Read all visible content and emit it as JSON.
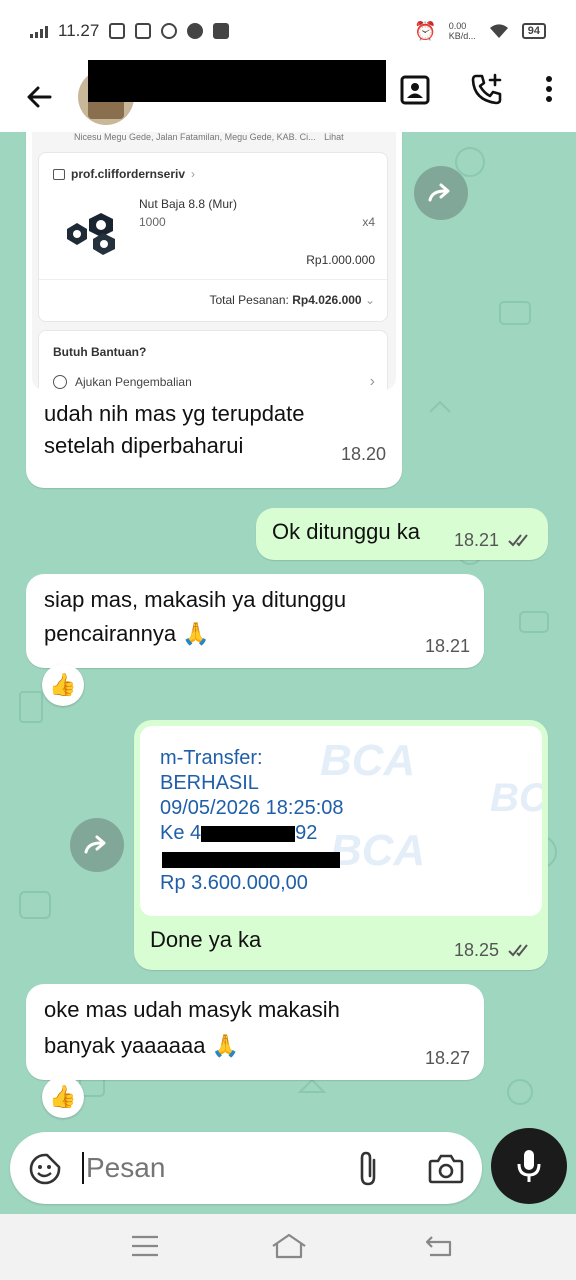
{
  "status_bar": {
    "time": "11.27",
    "net_speed_top": "0.00",
    "net_speed_bottom": "KB/d...",
    "battery": "94"
  },
  "header": {
    "back_icon": "arrow-left-icon",
    "contact_card_icon": "contact-card-icon",
    "add_call_icon": "phone-plus-icon",
    "menu_icon": "more-vertical-icon"
  },
  "messages": {
    "m1": {
      "screenshot": {
        "address_line": "Nicesu Megu Gede, Jalan Fatamilan, Megu Gede, KAB. Ci...",
        "address_link": "Lihat",
        "shop_name": "prof.cliffordernseriv",
        "product_name": "Nut Baja 8.8 (Mur)",
        "product_variant": "1000",
        "product_qty": "x4",
        "product_price": "Rp1.000.000",
        "total_label": "Total Pesanan:",
        "total_value": "Rp4.026.000",
        "help_title": "Butuh Bantuan?",
        "help_item": "Ajukan Pengembalian"
      },
      "text_line1": "udah nih mas yg terupdate",
      "text_line2": "setelah diperbaharui",
      "time": "18.20"
    },
    "m2": {
      "text": "Ok ditunggu ka",
      "time": "18.21"
    },
    "m3": {
      "text_line1": "siap mas, makasih ya ditunggu",
      "text_line2": "pencairannya 🙏",
      "time": "18.21",
      "reaction": "👍"
    },
    "m4": {
      "receipt": {
        "line1": "m-Transfer:",
        "line2": "BERHASIL",
        "line3": "09/05/2026 18:25:08",
        "line4_prefix": "Ke 4",
        "line4_suffix": "92",
        "line6": "Rp 3.600.000,00",
        "watermark": "BCA"
      },
      "text": "Done ya ka",
      "time": "18.25"
    },
    "m5": {
      "text_line1": "oke mas udah masyk makasih",
      "text_line2": "banyak yaaaaaa 🙏",
      "time": "18.27",
      "reaction": "👍"
    }
  },
  "input": {
    "placeholder": "Pesan",
    "emoji_icon": "sticker-icon",
    "attach_icon": "paperclip-icon",
    "camera_icon": "camera-icon",
    "mic_icon": "mic-icon"
  },
  "colors": {
    "chat_bg": "#9fd6c0",
    "incoming": "#ffffff",
    "outgoing": "#d9fdd3",
    "receipt_text": "#1f5fa8"
  }
}
